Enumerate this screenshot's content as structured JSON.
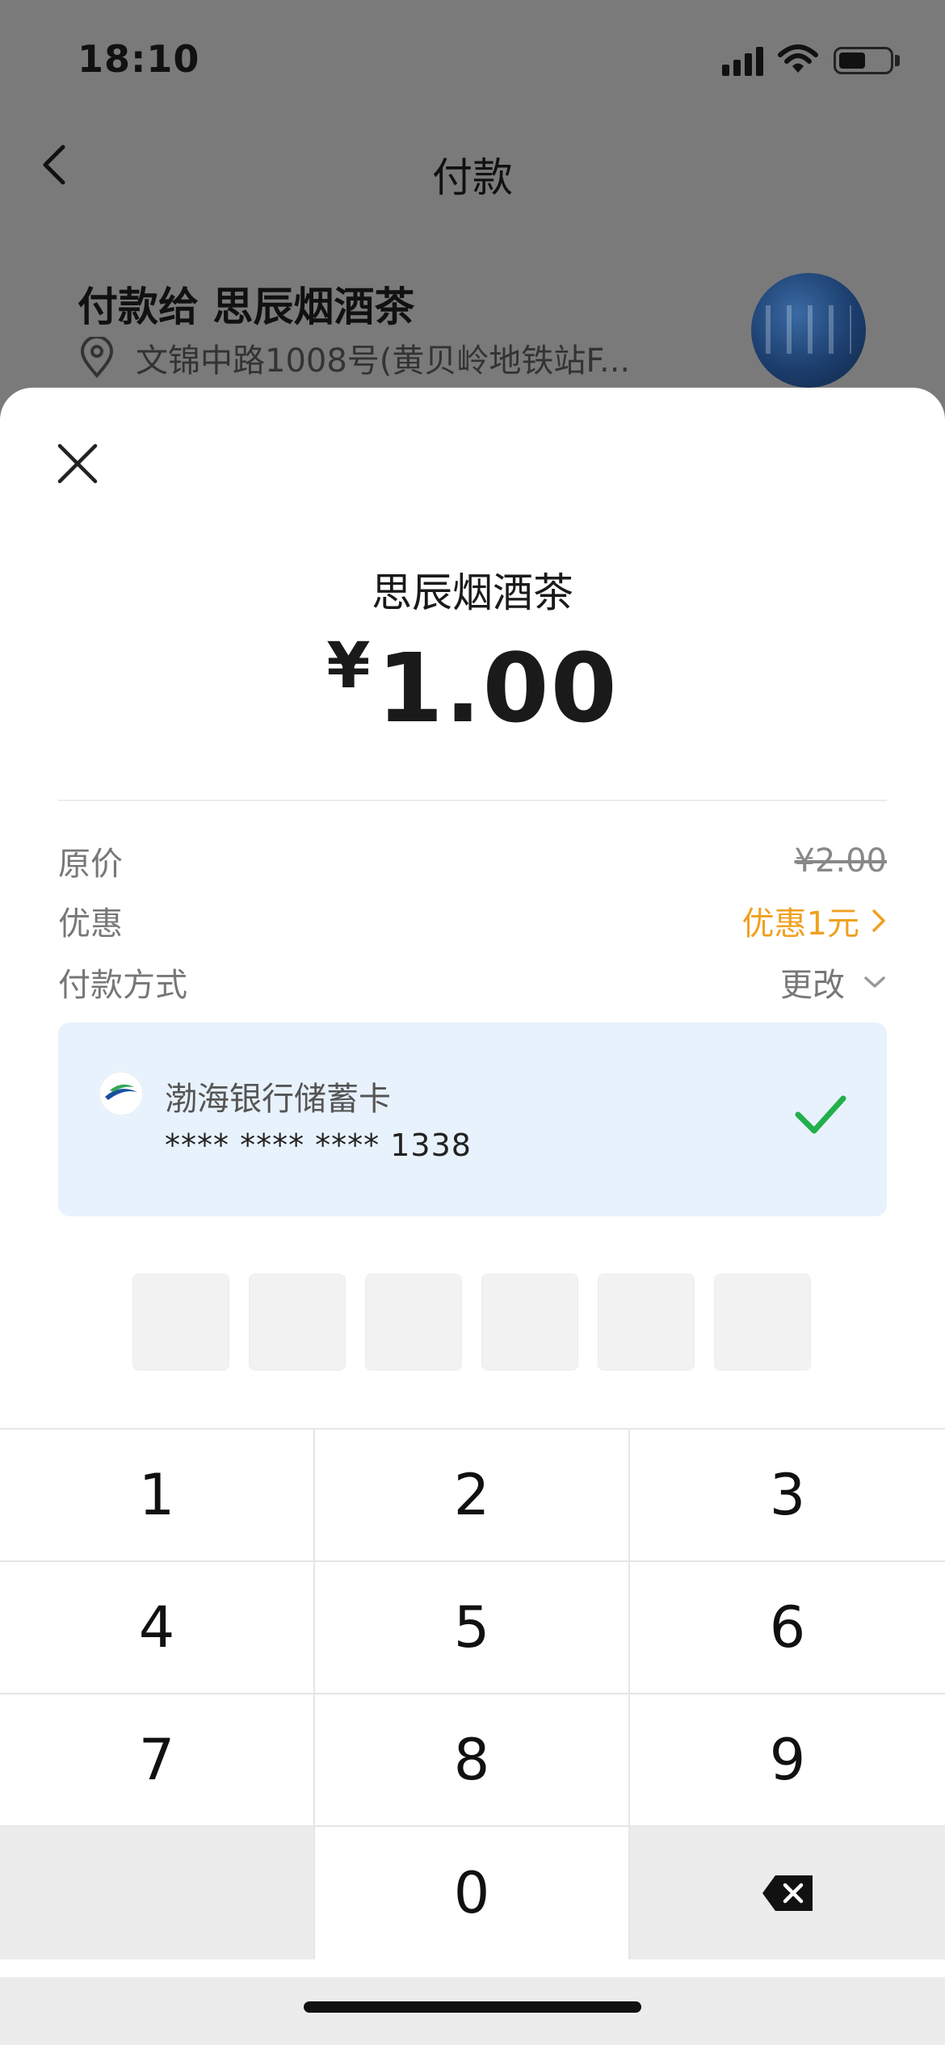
{
  "status_bar": {
    "time": "18:10"
  },
  "nav": {
    "title": "付款"
  },
  "merchant": {
    "pay_to": "付款给 思辰烟酒茶",
    "address": "文锦中路1008号(黄贝岭地铁站F..."
  },
  "sheet": {
    "merchant_name": "思辰烟酒茶",
    "currency_symbol": "¥",
    "amount": "1.00",
    "rows": {
      "original_price_label": "原价",
      "original_price_value": "¥2.00",
      "discount_label": "优惠",
      "discount_value": "优惠1元",
      "payment_method_label": "付款方式",
      "payment_method_action": "更改"
    },
    "card": {
      "bank_name": "渤海银行储蓄卡",
      "masked_number": "**** **** **** 1338"
    },
    "pin_length": 6
  },
  "keypad": {
    "keys": [
      "1",
      "2",
      "3",
      "4",
      "5",
      "6",
      "7",
      "8",
      "9",
      "0"
    ]
  },
  "colors": {
    "discount": "#f0a020",
    "check": "#22b04a",
    "card_bg": "#e8f2fd",
    "overlay": "#7a7a7a"
  },
  "icons": [
    "back-icon",
    "pin-icon",
    "close-icon",
    "chevron-right-icon",
    "chevron-down-icon",
    "bank-logo-icon",
    "check-icon",
    "backspace-icon"
  ]
}
